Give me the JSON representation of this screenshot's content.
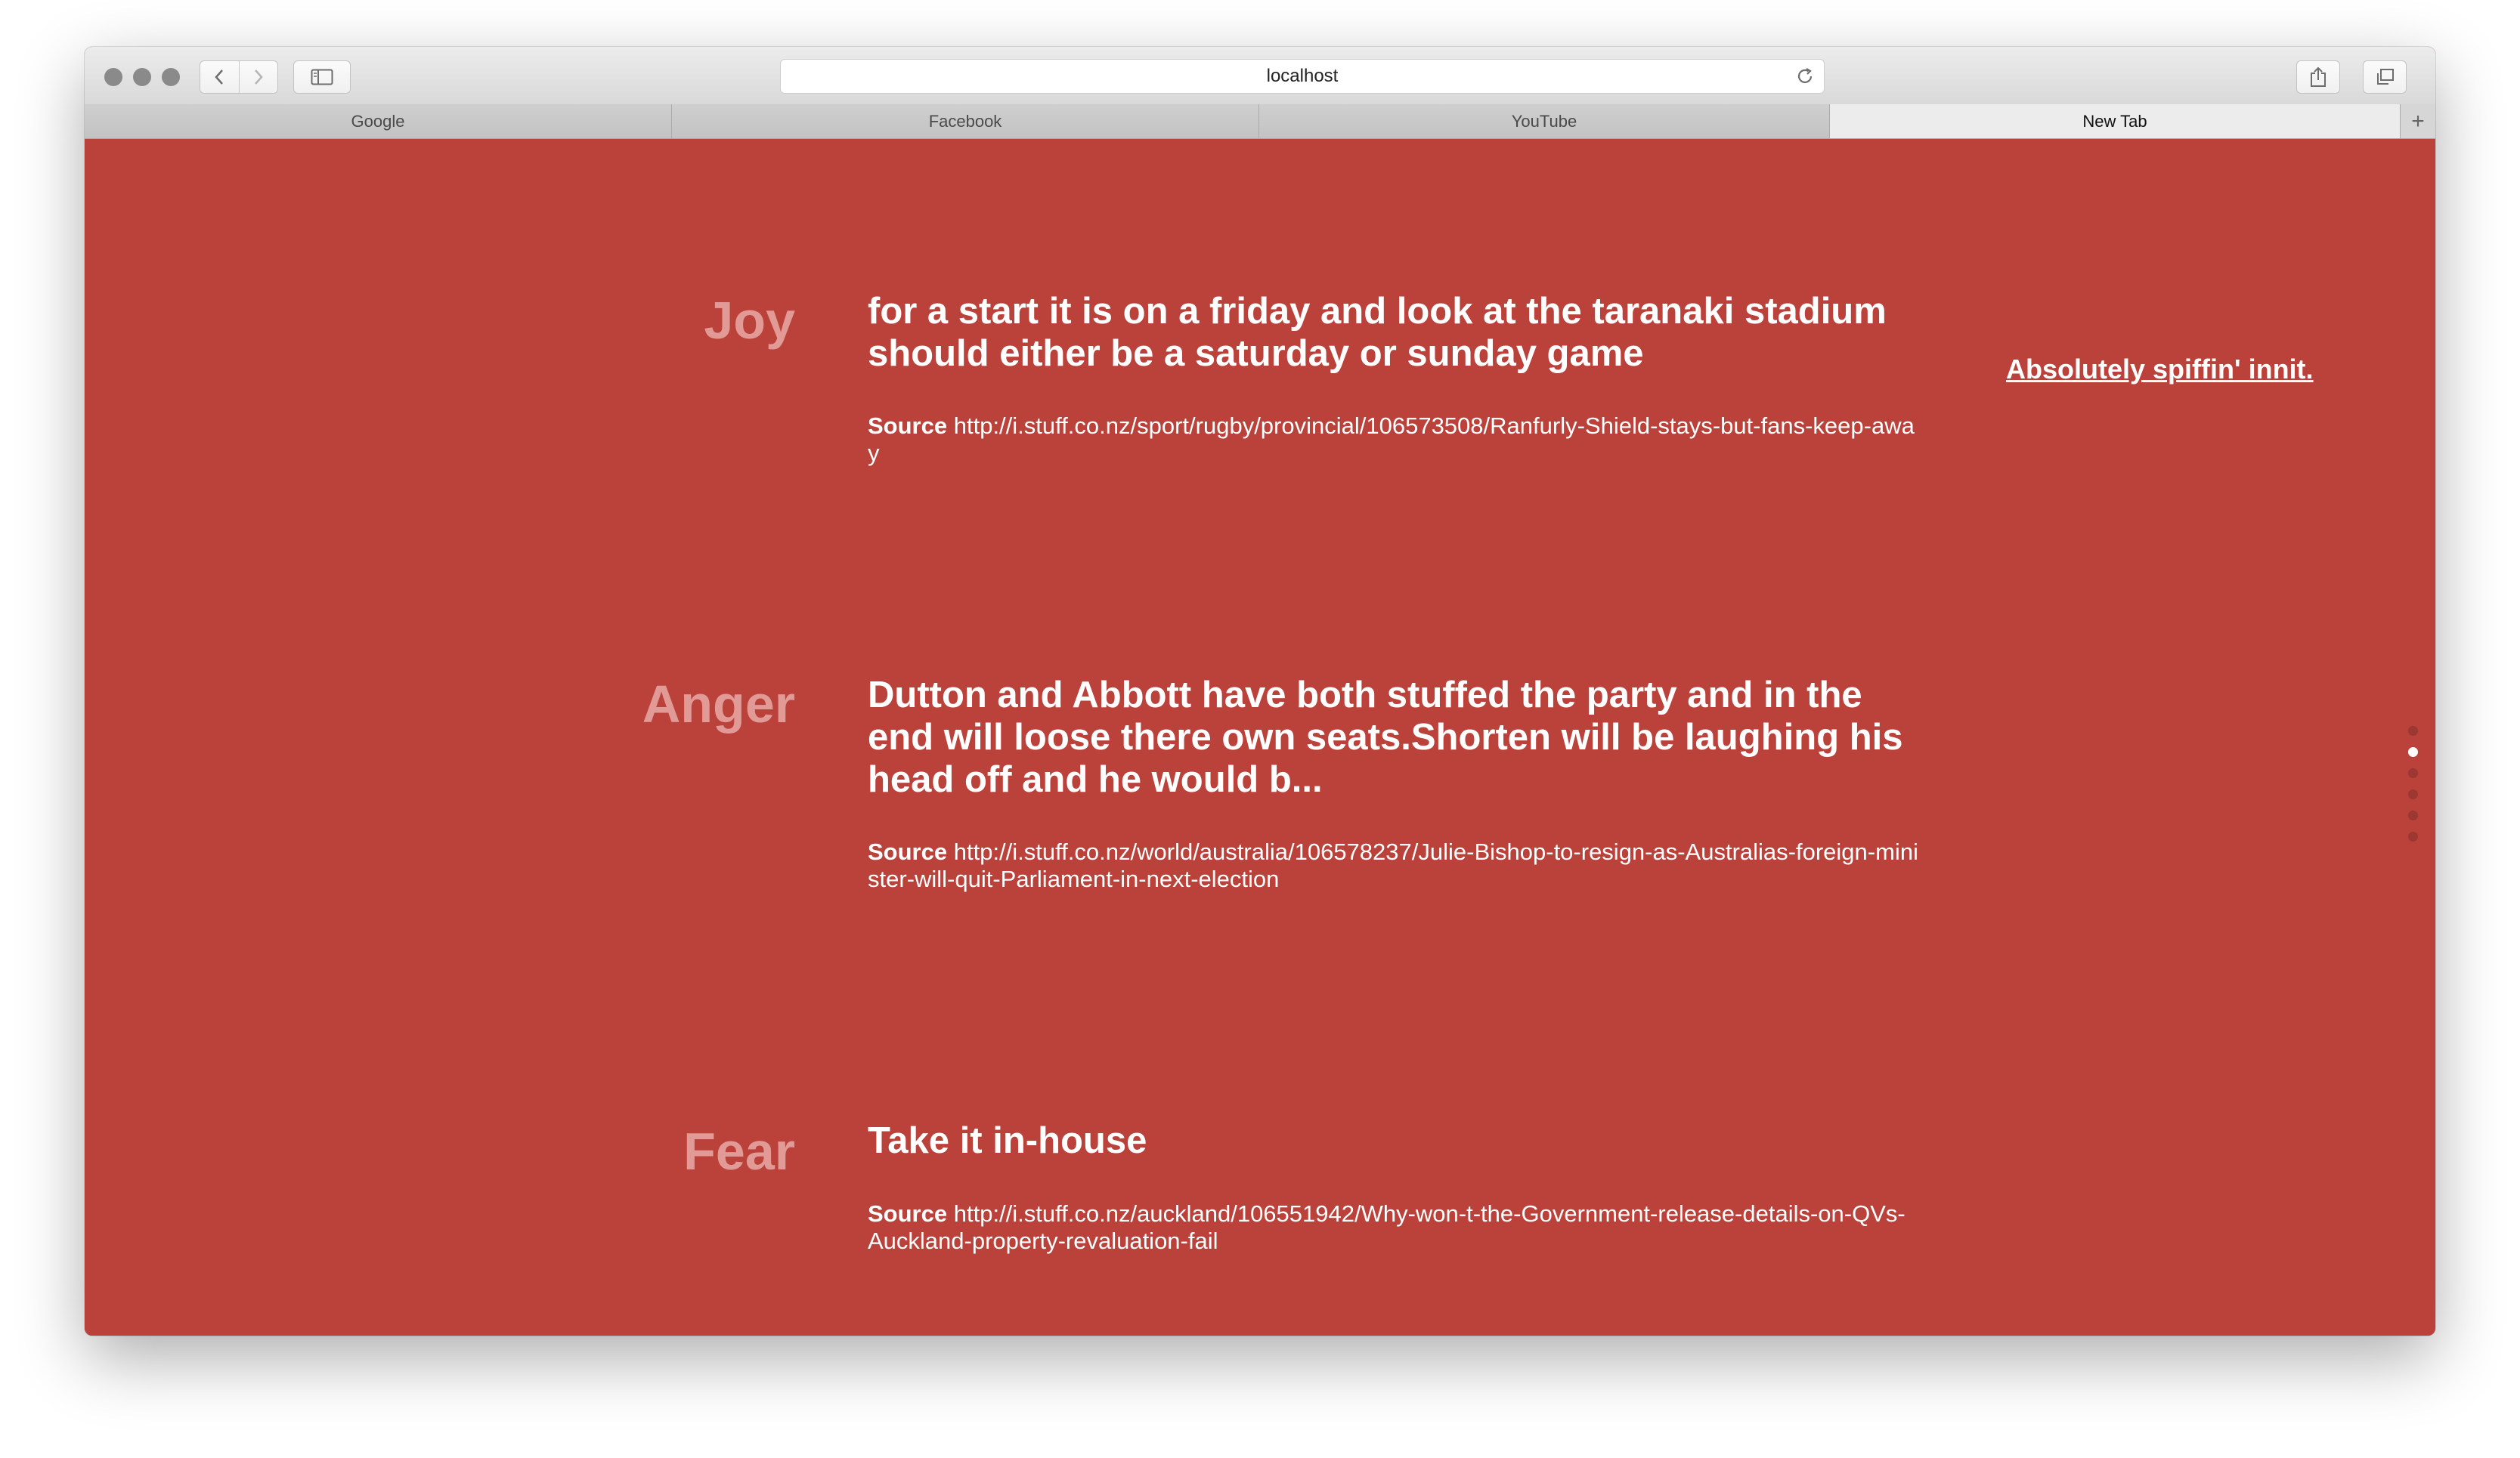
{
  "browser": {
    "address": "localhost",
    "tabs": [
      {
        "label": "Google",
        "active": false
      },
      {
        "label": "Facebook",
        "active": false
      },
      {
        "label": "YouTube",
        "active": false
      },
      {
        "label": "New Tab",
        "active": true
      }
    ],
    "new_tab_label": "+",
    "icons": [
      "back-icon",
      "forward-icon",
      "sidebar-icon",
      "reload-icon",
      "share-icon",
      "tabs-overview-icon"
    ]
  },
  "page": {
    "background_color": "#bb423b",
    "emotion_color": "#e19a96",
    "side_link": "Absolutely spiffin' innit.",
    "source_label": "Source",
    "items": [
      {
        "emotion": "Joy",
        "quote": "for a start it is on a friday and look at the taranaki stadium should either be a saturday or sunday game",
        "source_url": "http://i.stuff.co.nz/sport/rugby/provincial/106573508/Ranfurly-Shield-stays-but-fans-keep-away"
      },
      {
        "emotion": "Anger",
        "quote": "Dutton and Abbott have both stuffed the party and in the end will loose there own seats.Shorten will be laughing his head off and he would b...",
        "source_url": "http://i.stuff.co.nz/world/australia/106578237/Julie-Bishop-to-resign-as-Australias-foreign-minister-will-quit-Parliament-in-next-election"
      },
      {
        "emotion": "Fear",
        "quote": "Take it in-house",
        "source_url": "http://i.stuff.co.nz/auckland/106551942/Why-won-t-the-Government-release-details-on-QVs-Auckland-property-revaluation-fail"
      }
    ],
    "pagination": {
      "count": 6,
      "active_index": 1
    }
  }
}
